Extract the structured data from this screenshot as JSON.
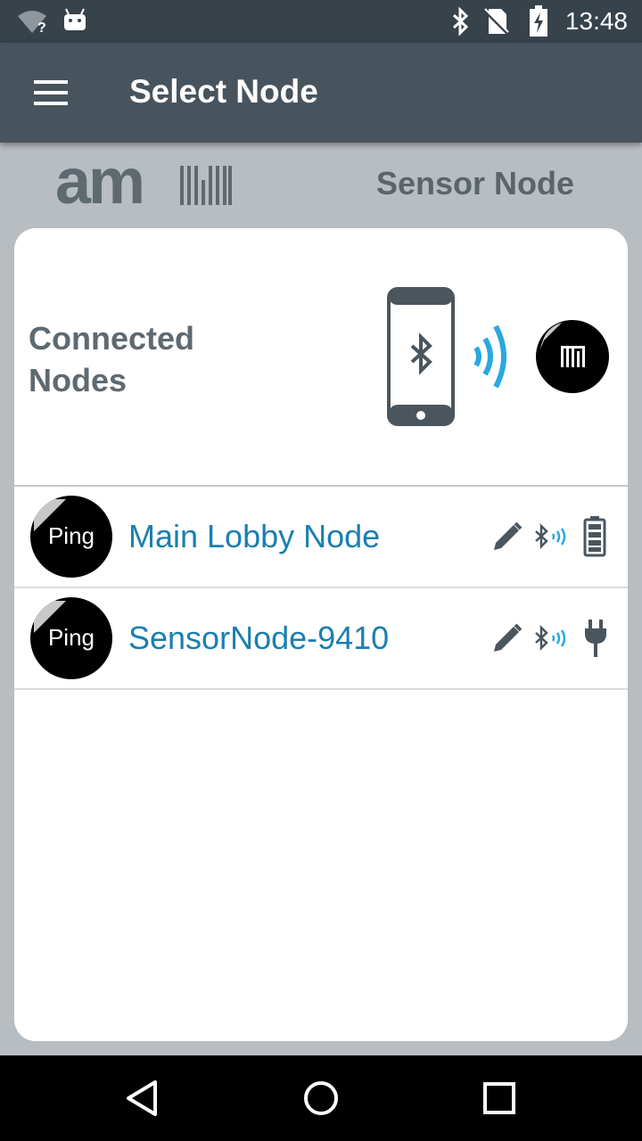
{
  "status_bar": {
    "time": "13:48",
    "icons": [
      "wifi-unknown-icon",
      "android-icon",
      "bluetooth-icon",
      "no-sim-icon",
      "battery-charging-icon"
    ]
  },
  "app_bar": {
    "title": "Select Node",
    "menu_icon": "hamburger-menu-icon"
  },
  "brand": {
    "logo_text": "am",
    "subtitle": "Sensor Node"
  },
  "connected": {
    "heading": "Connected Nodes",
    "hero_icons": [
      "phone-bluetooth-icon",
      "signal-waves-icon",
      "sensor-node-logo-icon"
    ]
  },
  "nodes": [
    {
      "ping_label": "Ping",
      "name": "Main Lobby Node",
      "power": "battery-icon"
    },
    {
      "ping_label": "Ping",
      "name": "SensorNode-9410",
      "power": "power-plug-icon"
    }
  ],
  "colors": {
    "status_bar": "#37424b",
    "app_bar": "#47545e",
    "background": "#b8bdc2",
    "node_link": "#1a7fb0",
    "signal_accent": "#29a8e0"
  },
  "nav_bar": {
    "icons": [
      "back-icon",
      "home-icon",
      "recents-icon"
    ]
  }
}
